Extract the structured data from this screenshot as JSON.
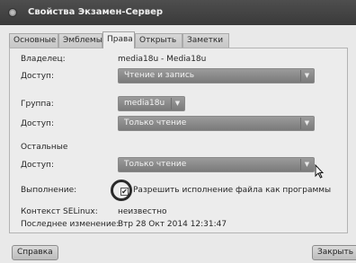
{
  "window": {
    "title": "Свойства Экзамен-Сервер"
  },
  "tabs": [
    {
      "label": "Основные"
    },
    {
      "label": "Эмблемы"
    },
    {
      "label": "Права"
    },
    {
      "label": "Открыть в"
    },
    {
      "label": "Заметки"
    }
  ],
  "permissions": {
    "owner_label": "Владелец:",
    "owner_value": "media18u - Media18u",
    "owner_access_label": "Доступ:",
    "owner_access_value": "Чтение и запись",
    "group_label": "Группа:",
    "group_value": "media18u",
    "group_access_label": "Доступ:",
    "group_access_value": "Только чтение",
    "others_heading": "Остальные",
    "others_access_label": "Доступ:",
    "others_access_value": "Только чтение",
    "execute_label": "Выполнение:",
    "execute_checkbox_label": "Разрешить исполнение файла как программы",
    "execute_checked": true,
    "selinux_label": "Контекст SELinux:",
    "selinux_value": "неизвестно",
    "modified_label": "Последнее изменение:",
    "modified_value": "Втр 28 Окт 2014 12:31:47"
  },
  "footer": {
    "help_label": "Справка",
    "close_label": "Закрыть"
  }
}
